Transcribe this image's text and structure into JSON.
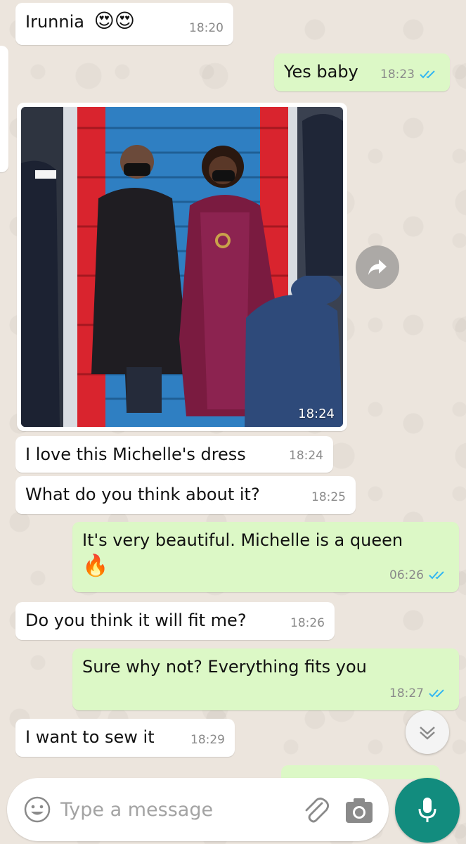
{
  "messages": [
    {
      "id": "m1",
      "direction": "incoming",
      "text": "Irunnia",
      "emojis": "😍😍",
      "time": "18:20"
    },
    {
      "id": "m2",
      "direction": "outgoing",
      "text": "Yes baby",
      "time": "18:23",
      "status": "read"
    },
    {
      "id": "m3",
      "direction": "incoming",
      "type": "photo",
      "time": "18:24"
    },
    {
      "id": "m4",
      "direction": "incoming",
      "text": "I love this Michelle's dress",
      "time": "18:24"
    },
    {
      "id": "m5",
      "direction": "incoming",
      "text": "What do you think about it?",
      "time": "18:25"
    },
    {
      "id": "m6",
      "direction": "outgoing",
      "text": "It's very beautiful. Michelle is a queen",
      "emojis": "🔥",
      "time": "06:26",
      "status": "read"
    },
    {
      "id": "m7",
      "direction": "incoming",
      "text": "Do you think it will fit me?",
      "time": "18:26"
    },
    {
      "id": "m8",
      "direction": "outgoing",
      "text": "Sure why not? Everything fits you",
      "time": "18:27",
      "status": "read"
    },
    {
      "id": "m9",
      "direction": "incoming",
      "text": "I want to sew it",
      "time": "18:29"
    }
  ],
  "composer": {
    "placeholder": "Type a message"
  },
  "icons": {
    "forward": "forward-icon",
    "scroll_down": "chevron-down-icon",
    "emoji": "emoji-icon",
    "attach": "paperclip-icon",
    "camera": "camera-icon",
    "mic": "mic-icon",
    "read_receipt": "double-check-icon"
  },
  "colors": {
    "incoming_bubble": "#ffffff",
    "outgoing_bubble": "#dcf8c6",
    "read_ticks": "#34b7f1",
    "accent": "#128c7e",
    "background": "#ece5dd"
  }
}
